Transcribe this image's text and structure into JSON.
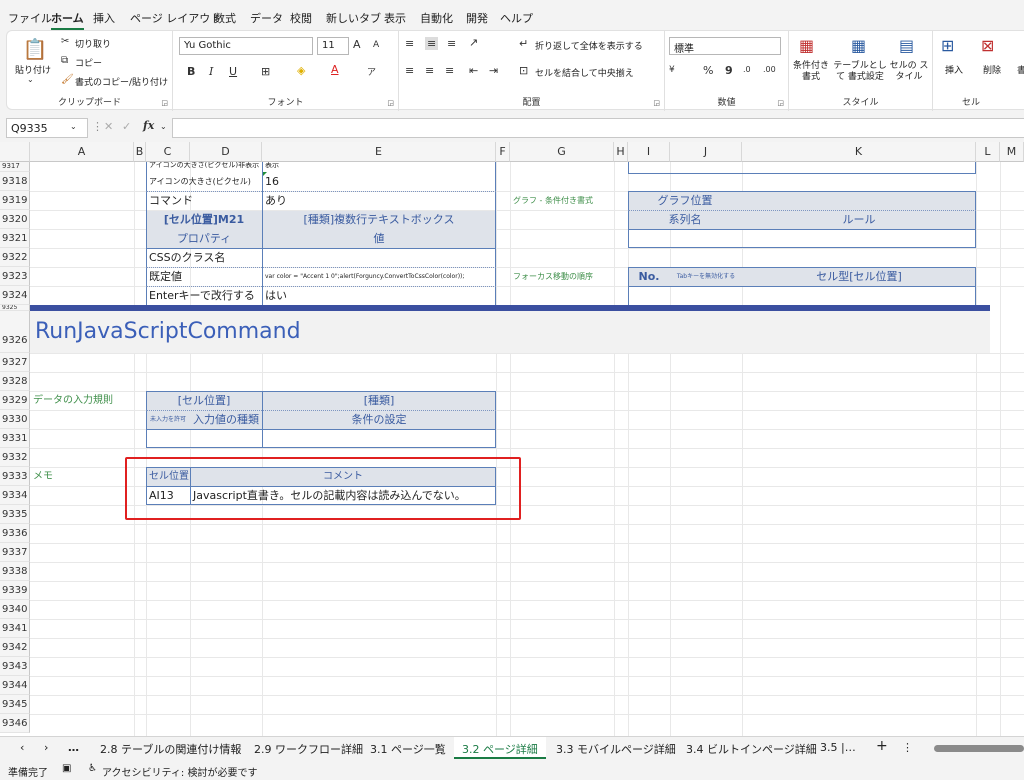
{
  "menu": {
    "items": [
      "ファイル",
      "ホーム",
      "挿入",
      "ページ レイアウト",
      "数式",
      "データ",
      "校閲",
      "新しいタブ",
      "表示",
      "自動化",
      "開発",
      "ヘルプ"
    ],
    "active": "ホーム"
  },
  "ribbon": {
    "clipboard": {
      "paste": "貼り付け",
      "cut": "切り取り",
      "copy": "コピー",
      "format_painter": "書式のコピー/貼り付け",
      "label": "クリップボード"
    },
    "font": {
      "name": "Yu Gothic",
      "size": "11",
      "bold": "B",
      "italic": "I",
      "underline": "U",
      "grow": "A",
      "shrink": "A",
      "label": "フォント"
    },
    "alignment": {
      "wrap": "折り返して全体を表示する",
      "merge": "セルを結合して中央揃え",
      "label": "配置"
    },
    "number": {
      "format": "標準",
      "percent": "%",
      "comma": "9",
      "label": "数値"
    },
    "styles": {
      "conditional": "条件付き 書式",
      "table": "テーブルとして 書式設定",
      "cell": "セルの スタイル",
      "label": "スタイル"
    },
    "cells": {
      "insert": "挿入",
      "delete": "削除",
      "format": "書",
      "label": "セル"
    }
  },
  "formula_bar": {
    "name_box": "Q9335",
    "fx": "fx",
    "value": ""
  },
  "columns": [
    "A",
    "B",
    "C",
    "D",
    "E",
    "F",
    "G",
    "H",
    "I",
    "J",
    "K",
    "L",
    "M"
  ],
  "rows": [
    "9317",
    "9318",
    "9319",
    "9320",
    "9321",
    "9322",
    "9323",
    "9324",
    "9325",
    "9326",
    "9327",
    "9328",
    "9329",
    "9330",
    "9331",
    "9332",
    "9333",
    "9334",
    "9335",
    "9336",
    "9337",
    "9338",
    "9339",
    "9340",
    "9341",
    "9342",
    "9343",
    "9344",
    "9345",
    "9346"
  ],
  "cells": {
    "r9317_cd": "アイコンの大きさ(ピクセル)非表示",
    "r9317_e": "表示",
    "r9318_cd": "アイコンの大きさ(ピクセル)",
    "r9318_e": "16",
    "r9319_cd": "コマンド",
    "r9319_e": "あり",
    "r9320_cd": "[セル位置]M21",
    "r9320_e": "[種類]複数行テキストボックス",
    "r9321_cd": "プロパティ",
    "r9321_e": "値",
    "r9322_cd": "CSSのクラス名",
    "r9323_cd": "既定値",
    "r9323_e": "var color = \"Accent 1 0\";alert(Forguncy.ConvertToCssColor(color));",
    "r9324_cd": "Enterキーで改行する",
    "r9324_e": "はい",
    "graph_label": "グラフ - 条件付き書式",
    "graph_pos": "グラフ位置",
    "series": "系列名",
    "rule": "ルール",
    "focus_label": "フォーカス移動の順序",
    "no": "No.",
    "tab_key": "Tabキーを無効化する",
    "cell_type": "セル型[セル位置]",
    "heading": "RunJavaScriptCommand",
    "validation_label": "データの入力規則",
    "v_cell": "[セル位置]",
    "v_kind": "[種類]",
    "v_null": "未入力を許可",
    "v_type": "入力値の種類",
    "v_cond": "条件の設定",
    "memo_label": "メモ",
    "m_cell": "セル位置",
    "m_comment": "コメント",
    "m_cell_val": "AI13",
    "m_comment_val": "Javascript直書き。セルの記載内容は読み込んでない。"
  },
  "tabs": {
    "more": "…",
    "t1": "2.8 テーブルの関連付け情報",
    "t2": "2.9 ワークフロー詳細",
    "t3": "3.1 ページ一覧",
    "t4": "3.2 ページ詳細",
    "t5": "3.3 モバイルページ詳細",
    "t6": "3.4 ビルトインページ詳細",
    "t7": "3.5 |…",
    "add": "+"
  },
  "status": {
    "ready": "準備完了",
    "accessibility": "アクセシビリティ: 検討が必要です"
  },
  "colors": {
    "accent": "#1a7b44",
    "header_blue": "#3b4fa0",
    "highlight": "#e02020"
  }
}
